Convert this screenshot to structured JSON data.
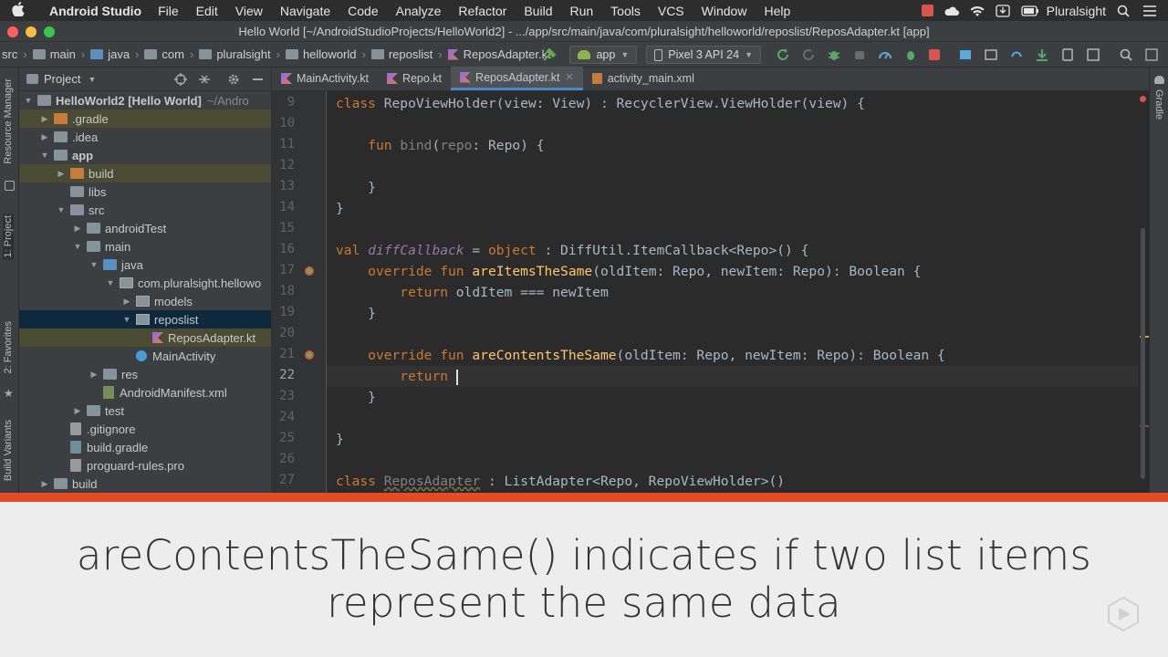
{
  "menubar": {
    "app_name": "Android Studio",
    "items": [
      "File",
      "Edit",
      "View",
      "Navigate",
      "Code",
      "Analyze",
      "Refactor",
      "Build",
      "Run",
      "Tools",
      "VCS",
      "Window",
      "Help"
    ],
    "right_label": "Pluralsight"
  },
  "window": {
    "title": "Hello World [~/AndroidStudioProjects/HelloWorld2] - .../app/src/main/java/com/pluralsight/helloworld/reposlist/ReposAdapter.kt [app]"
  },
  "breadcrumb": [
    "src",
    "main",
    "java",
    "com",
    "pluralsight",
    "helloworld",
    "reposlist",
    "ReposAdapter.kt"
  ],
  "toolbar": {
    "config": "app",
    "device": "Pixel 3 API 24"
  },
  "left_stripe": {
    "resource_manager": "Resource Manager",
    "project": "1: Project",
    "favorites": "2: Favorites",
    "build_variants": "Build Variants"
  },
  "right_stripe": {
    "gradle": "Gradle"
  },
  "project_panel": {
    "title": "Project",
    "tree": [
      {
        "label": "HelloWorld2 [Hello World]",
        "suffix": "~/Andro",
        "indent": 0,
        "arrow": "▼",
        "icon": "folder-gray",
        "bold": true
      },
      {
        "label": ".gradle",
        "indent": 1,
        "arrow": "▶",
        "icon": "folder-orange",
        "hl": true
      },
      {
        "label": ".idea",
        "indent": 1,
        "arrow": "▶",
        "icon": "folder-gray"
      },
      {
        "label": "app",
        "indent": 1,
        "arrow": "▼",
        "icon": "folder-gray",
        "bold": true
      },
      {
        "label": "build",
        "indent": 2,
        "arrow": "▶",
        "icon": "folder-orange",
        "hl": true
      },
      {
        "label": "libs",
        "indent": 2,
        "arrow": "",
        "icon": "folder-gray"
      },
      {
        "label": "src",
        "indent": 2,
        "arrow": "▼",
        "icon": "folder-gray"
      },
      {
        "label": "androidTest",
        "indent": 3,
        "arrow": "▶",
        "icon": "folder-gray"
      },
      {
        "label": "main",
        "indent": 3,
        "arrow": "▼",
        "icon": "folder-gray"
      },
      {
        "label": "java",
        "indent": 4,
        "arrow": "▼",
        "icon": "folder-blue"
      },
      {
        "label": "com.pluralsight.hellowo",
        "indent": 5,
        "arrow": "▼",
        "icon": "package"
      },
      {
        "label": "models",
        "indent": 6,
        "arrow": "▶",
        "icon": "package"
      },
      {
        "label": "reposlist",
        "indent": 6,
        "arrow": "▼",
        "icon": "package",
        "selected": true
      },
      {
        "label": "ReposAdapter.kt",
        "indent": 7,
        "arrow": "",
        "icon": "kotlin",
        "hl": true
      },
      {
        "label": "MainActivity",
        "indent": 6,
        "arrow": "",
        "icon": "class"
      },
      {
        "label": "res",
        "indent": 4,
        "arrow": "▶",
        "icon": "folder-gray"
      },
      {
        "label": "AndroidManifest.xml",
        "indent": 4,
        "arrow": "",
        "icon": "manifest"
      },
      {
        "label": "test",
        "indent": 3,
        "arrow": "▶",
        "icon": "folder-gray"
      },
      {
        "label": ".gitignore",
        "indent": 2,
        "arrow": "",
        "icon": "file"
      },
      {
        "label": "build.gradle",
        "indent": 2,
        "arrow": "",
        "icon": "gradle"
      },
      {
        "label": "proguard-rules.pro",
        "indent": 2,
        "arrow": "",
        "icon": "file"
      },
      {
        "label": "build",
        "indent": 1,
        "arrow": "▶",
        "icon": "folder-gray"
      }
    ]
  },
  "editor_tabs": [
    {
      "label": "MainActivity.kt",
      "active": false
    },
    {
      "label": "Repo.kt",
      "active": false
    },
    {
      "label": "ReposAdapter.kt",
      "active": true
    },
    {
      "label": "activity_main.xml",
      "active": false
    }
  ],
  "code_lines": [
    {
      "num": "9",
      "html": "<span class=\"kw\">class</span> RepoViewHolder(view: View) : RecyclerView.ViewHolder(view) {"
    },
    {
      "num": "10",
      "html": ""
    },
    {
      "num": "11",
      "html": "    <span class=\"kw\">fun</span> <span class=\"gr\">bind</span>(<span class=\"gr\">repo</span>: Repo) {"
    },
    {
      "num": "12",
      "html": ""
    },
    {
      "num": "13",
      "html": "    }"
    },
    {
      "num": "14",
      "html": "}"
    },
    {
      "num": "15",
      "html": ""
    },
    {
      "num": "16",
      "html": "<span class=\"kw\">val</span> <span class=\"it\">diffCallback</span> = <span class=\"kw\">object</span> : DiffUtil.ItemCallback&lt;Repo&gt;() {"
    },
    {
      "num": "17",
      "html": "    <span class=\"kw\">override fun</span> <span class=\"fn\">areItemsTheSame</span>(oldItem: Repo, newItem: Repo): Boolean {",
      "marker": true
    },
    {
      "num": "18",
      "html": "        <span class=\"kw\">return</span> oldItem === newItem"
    },
    {
      "num": "19",
      "html": "    }"
    },
    {
      "num": "20",
      "html": ""
    },
    {
      "num": "21",
      "html": "    <span class=\"kw\">override fun</span> <span class=\"fn\">areContentsTheSame</span>(oldItem: Repo, newItem: Repo): Boolean {",
      "marker": true
    },
    {
      "num": "22",
      "html": "        <span class=\"kw\">return</span> <span class=\"caret\"></span>",
      "current": true
    },
    {
      "num": "23",
      "html": "    }"
    },
    {
      "num": "24",
      "html": ""
    },
    {
      "num": "25",
      "html": "}"
    },
    {
      "num": "26",
      "html": ""
    },
    {
      "num": "27",
      "html": "<span class=\"kw\">class</span> <span class=\"gr ul\">ReposAdapter</span> : ListAdapter&lt;Repo, RepoViewHolder&gt;()"
    }
  ],
  "caption": {
    "text": "areContentsTheSame() indicates if two list items represent the same data"
  },
  "colors": {
    "accent_orange": "#e54c26",
    "keyword": "#cc7832",
    "function": "#ffc66d",
    "property": "#9876aa"
  }
}
